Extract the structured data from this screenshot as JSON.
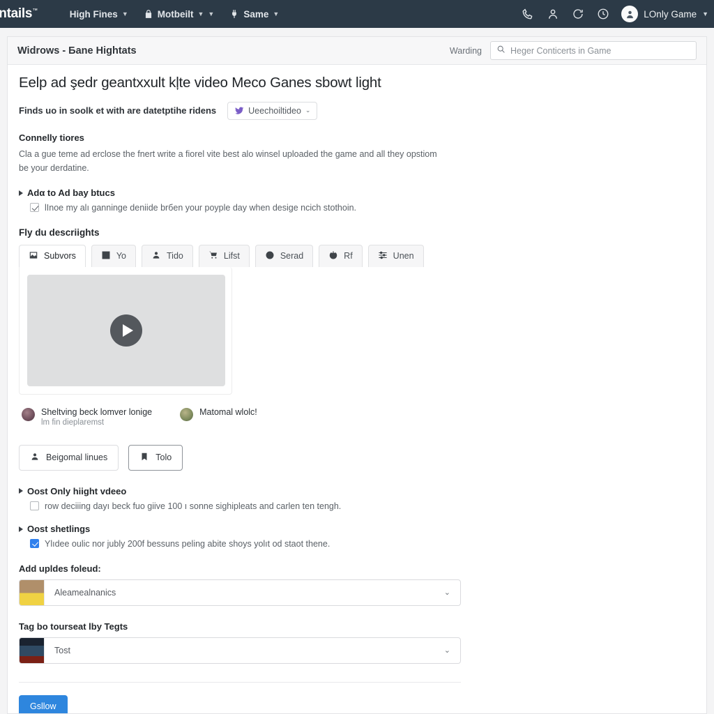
{
  "topnav": {
    "brand": "entails",
    "brand_sup": "™",
    "items": [
      {
        "label": "High Fines",
        "icon": "",
        "caret": "▼"
      },
      {
        "label": "Motbeilt",
        "icon": "lock-icon",
        "caret": "▼"
      },
      {
        "label": "Same",
        "icon": "plug-icon",
        "caret": "▼"
      }
    ],
    "right_icons": [
      "phone-icon",
      "person-icon",
      "refresh-icon",
      "clock-icon"
    ],
    "user": {
      "name": "LOnly Game",
      "caret": "▼"
    }
  },
  "card": {
    "title": "Widrows - Бane Hightats",
    "warding_label": "Warding",
    "search": {
      "value": "Heger Conticerts in Game",
      "placeholder": "Heger Conticerts in Game"
    }
  },
  "main": {
    "heading": "Eelp ad şedr geantxxult kļte video Meco Ganes sbowt light",
    "subtitle": "Finds uo in soolk et with are datetptihe ridens",
    "source_pill": {
      "label": "Ueechoiltideo",
      "caret": "⌄"
    },
    "section_title": "Connelly tiores",
    "paragraph": "Cla a gue teme ad erclose the fnert write a fiorel vite best alo winsel uploaded the game and all they opstiom be your derdatine.",
    "disclosure_1": {
      "label": "Adα to Ad bay btucs",
      "check_label": "lInoe my alı ganninge deniide brбen your poyple day when desige ncich stothoin."
    },
    "tabs_title": "Fly du descriights",
    "tabs": [
      {
        "label": "Subvors",
        "icon": "image-icon",
        "active": true
      },
      {
        "label": "Yo",
        "icon": "grid-icon",
        "active": false
      },
      {
        "label": "Tido",
        "icon": "person-icon",
        "active": false
      },
      {
        "label": "Lifst",
        "icon": "cart-icon",
        "active": false
      },
      {
        "label": "Serad",
        "icon": "target-icon",
        "active": false
      },
      {
        "label": "Rf",
        "icon": "power-icon",
        "active": false
      },
      {
        "label": "Unen",
        "icon": "sliders-icon",
        "active": false
      }
    ],
    "users": [
      {
        "title": "Sheltving beck lomver lonige",
        "subtitle": "lm fin dieplaremst",
        "avatar": "avatar-purple"
      },
      {
        "title": "Matomal wlolc!",
        "subtitle": "",
        "avatar": "avatar-green"
      }
    ],
    "actions": [
      {
        "label": "Beigomal linues",
        "icon": "person-icon",
        "strong": false
      },
      {
        "label": "Tolo",
        "icon": "bookmark-icon",
        "strong": true
      }
    ],
    "disclosure_2": {
      "label": "Oost Only hiight vdeeo",
      "check_label": "row deciiing dayı beck fuo giive 100 ı sonne sighipleats and carlen ten tengh.",
      "checked": false
    },
    "disclosure_3": {
      "label": "Oost shetlings",
      "check_label": "Ylıdee oulic nor jubly 200f bessuns peling abite shoys yolıt od staot thene.",
      "checked": true
    },
    "select_1": {
      "label": "Add upldes foleud:",
      "value": "Aleamealnanics",
      "caret": "⌄"
    },
    "select_2": {
      "label": "Tag bo tourseat lby Tegts",
      "value": "Tost",
      "caret": "⌄"
    },
    "submit_label": "Gsllow"
  },
  "colors": {
    "navbar": "#2c3a47",
    "accent": "#2e86de",
    "checkbox_on": "#2f80ed",
    "pill_icon": "#7b5ec7"
  }
}
